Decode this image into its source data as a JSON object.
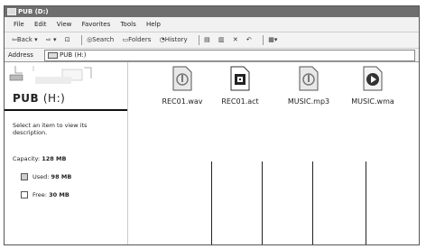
{
  "window": {
    "title": "PUB (D:)"
  },
  "menu": [
    "File",
    "Edit",
    "View",
    "Favorites",
    "Tools",
    "Help"
  ],
  "toolbar": {
    "back_label": "Back",
    "search_label": "Search",
    "folders_label": "Folders",
    "history_label": "History"
  },
  "address": {
    "label": "Address",
    "value": "PUB (H:)"
  },
  "left_pane": {
    "title_main": "PUB",
    "title_drive": "(H:)",
    "description": "Select an item to view its description.",
    "capacity_label": "Capacity:",
    "capacity_value": "128 MB",
    "used_label": "Used:",
    "used_value": "98 MB",
    "free_label": "Free:",
    "free_value": "30 MB"
  },
  "files": [
    {
      "name": "REC01.wav",
      "icon": "wav-file-icon"
    },
    {
      "name": "REC01.act",
      "icon": "act-file-icon"
    },
    {
      "name": "MUSIC.mp3",
      "icon": "mp3-file-icon"
    },
    {
      "name": "MUSIC.wma",
      "icon": "wma-file-icon"
    }
  ]
}
